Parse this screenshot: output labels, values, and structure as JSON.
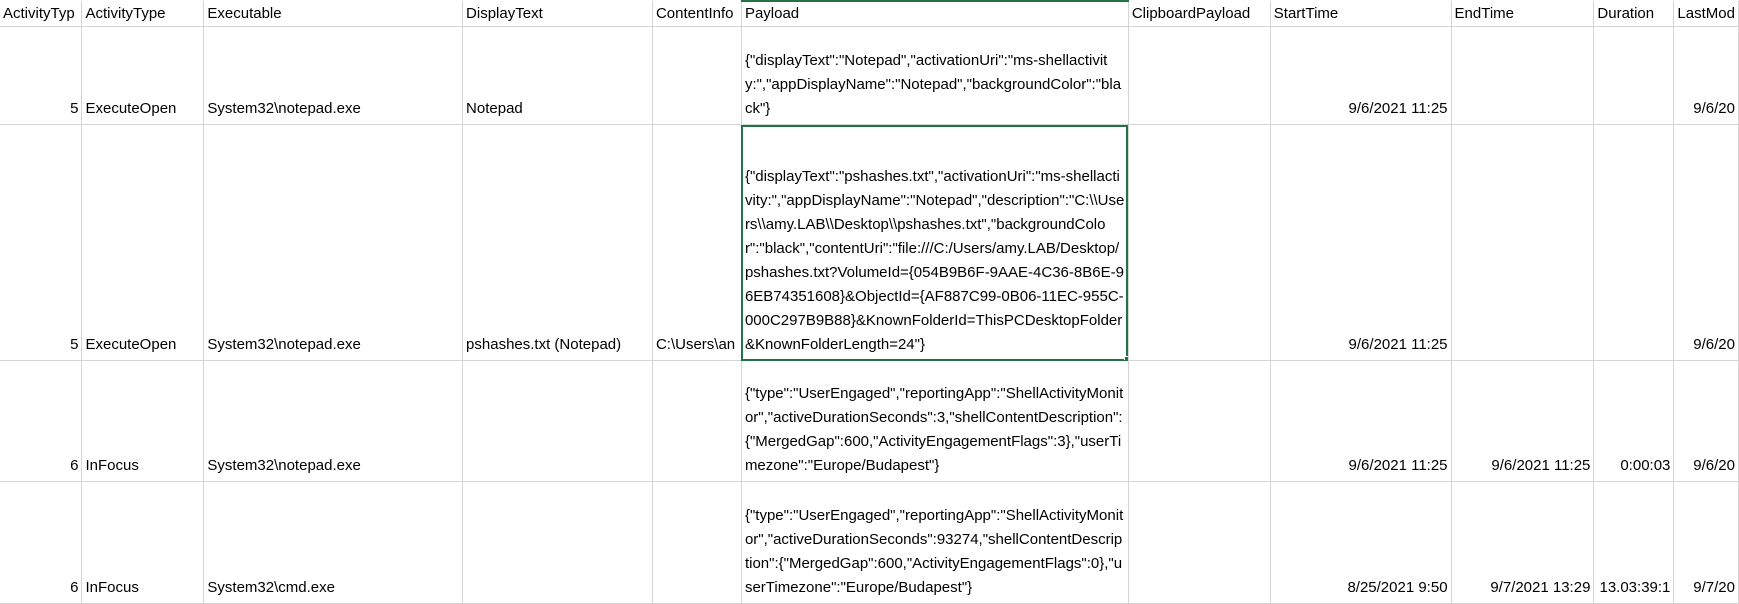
{
  "columns": [
    "ActivityTyp",
    "ActivityType",
    "Executable",
    "DisplayText",
    "ContentInfo",
    "Payload",
    "ClipboardPayload",
    "StartTime",
    "EndTime",
    "Duration",
    "LastMod"
  ],
  "rows": [
    {
      "activity_type_id": "5",
      "activity_type": "ExecuteOpen",
      "executable": "System32\\notepad.exe",
      "display_text": "Notepad",
      "content_info": "",
      "payload": "{\"displayText\":\"Notepad\",\"activationUri\":\"ms-shellactivity:\",\"appDisplayName\":\"Notepad\",\"backgroundColor\":\"black\"}",
      "clipboard_payload": "",
      "start_time": "9/6/2021 11:25",
      "end_time": "",
      "duration": "",
      "last_mod": "9/6/20"
    },
    {
      "activity_type_id": "5",
      "activity_type": "ExecuteOpen",
      "executable": "System32\\notepad.exe",
      "display_text": "pshashes.txt (Notepad)",
      "content_info": "C:\\Users\\an",
      "payload": "{\"displayText\":\"pshashes.txt\",\"activationUri\":\"ms-shellactivity:\",\"appDisplayName\":\"Notepad\",\"description\":\"C:\\\\Users\\\\amy.LAB\\\\Desktop\\\\pshashes.txt\",\"backgroundColor\":\"black\",\"contentUri\":\"file:///C:/Users/amy.LAB/Desktop/pshashes.txt?VolumeId={054B9B6F-9AAE-4C36-8B6E-96EB74351608}&ObjectId={AF887C99-0B06-11EC-955C-000C297B9B88}&KnownFolderId=ThisPCDesktopFolder&KnownFolderLength=24\"}",
      "clipboard_payload": "",
      "start_time": "9/6/2021 11:25",
      "end_time": "",
      "duration": "",
      "last_mod": "9/6/20"
    },
    {
      "activity_type_id": "6",
      "activity_type": "InFocus",
      "executable": "System32\\notepad.exe",
      "display_text": "",
      "content_info": "",
      "payload": "{\"type\":\"UserEngaged\",\"reportingApp\":\"ShellActivityMonitor\",\"activeDurationSeconds\":3,\"shellContentDescription\":{\"MergedGap\":600,\"ActivityEngagementFlags\":3},\"userTimezone\":\"Europe/Budapest\"}",
      "clipboard_payload": "",
      "start_time": "9/6/2021 11:25",
      "end_time": "9/6/2021 11:25",
      "duration": "0:00:03",
      "last_mod": "9/6/20"
    },
    {
      "activity_type_id": "6",
      "activity_type": "InFocus",
      "executable": "System32\\cmd.exe",
      "display_text": "",
      "content_info": "",
      "payload": "{\"type\":\"UserEngaged\",\"reportingApp\":\"ShellActivityMonitor\",\"activeDurationSeconds\":93274,\"shellContentDescription\":{\"MergedGap\":600,\"ActivityEngagementFlags\":0},\"userTimezone\":\"Europe/Budapest\"}",
      "clipboard_payload": "",
      "start_time": "8/25/2021 9:50",
      "end_time": "9/7/2021 13:29",
      "duration": "13.03:39:1",
      "last_mod": "9/7/20"
    }
  ],
  "colors": {
    "grid": "#d4d4d4",
    "selection": "#217346"
  }
}
